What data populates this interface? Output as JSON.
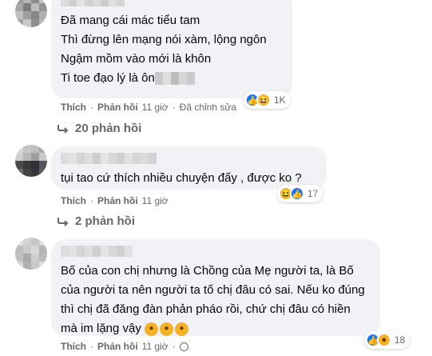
{
  "comments": [
    {
      "lines": [
        "Đã mang cái mác tiểu tam",
        "Thì đừng lên mạng nói xàm, lộng ngôn",
        "Ngậm mồm vào mới là khôn",
        "Ti toe đạo lý là ôn"
      ],
      "actions": {
        "like": "Thích",
        "reply": "Phản hồi",
        "time": "11 giờ",
        "edited": "Đã chỉnh sửa"
      },
      "reaction_icons": [
        "like-icon",
        "haha-icon"
      ],
      "reaction_count": "1K",
      "replies_label": "20 phản hồi"
    },
    {
      "lines": [
        "tụi tao cứ thích nhiều chuyện đấy , được ko ?"
      ],
      "actions": {
        "like": "Thích",
        "reply": "Phản hồi",
        "time": "11 giờ"
      },
      "reaction_icons": [
        "haha-icon",
        "like-icon"
      ],
      "reaction_count": "17",
      "replies_label": "2 phản hồi"
    },
    {
      "lines": [
        "Bố của con chị nhưng là Chồng của Mẹ người ta, là Bố",
        "của người ta nên người ta tố chị đâu có sai. Nếu ko đúng",
        "thì chị đã đăng đàn phản pháo rồi, chứ chị đâu có hiền",
        "mà im lặng vậy"
      ],
      "actions": {
        "like": "Thích",
        "reply": "Phản hồi",
        "time": "11 giờ"
      },
      "reaction_icons": [
        "like-icon",
        "sad-icon"
      ],
      "reaction_count": "18"
    }
  ],
  "colors": {
    "bubble": "#f0f2f5",
    "meta": "#65676b",
    "like": "#1877f2",
    "emoji": "#f7b125"
  }
}
